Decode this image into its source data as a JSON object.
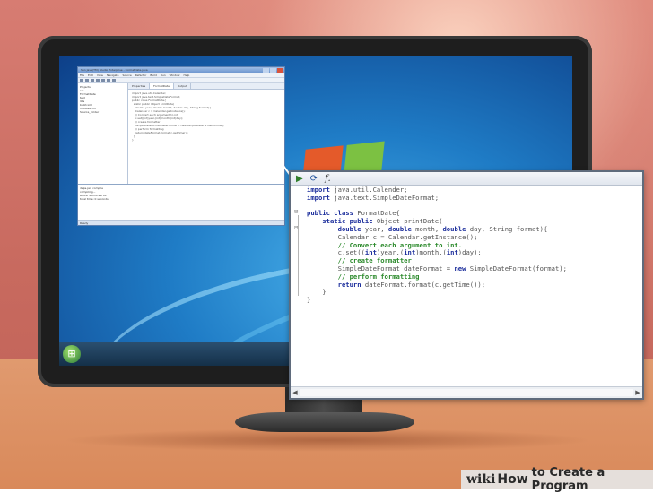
{
  "colors": {
    "wall": "#c86a5f",
    "desk": "#d9895a",
    "keyword": "#1c2e9c",
    "comment": "#2c8a2c",
    "plain": "#555555"
  },
  "ide": {
    "title": "Sun Java(TM) Studio Enterprise - FormatDate.java",
    "menu": [
      "File",
      "Edit",
      "View",
      "Navigate",
      "Source",
      "Refactor",
      "Build",
      "Run",
      "Window",
      "Help"
    ],
    "tree": [
      "Projects",
      "src",
      "FormatDate",
      "test",
      "libs",
      "build.xml",
      "manifest.mf",
      "Source_Folder"
    ],
    "tabs": [
      "Properties",
      "FormatDate",
      "Output"
    ],
    "code_preview": [
      "import java.util.Calender;",
      "import java.text.SimpleDateFormat;",
      "",
      "public class FormatDate{",
      "  static public Object printDate(",
      "    double year, double month, double day, String format){",
      "    Calendar c = Calendar.getInstance();",
      "    // Convert each argument to int.",
      "    c.set((int)year,(int)month,(int)day);",
      "    // create formatter",
      "    SimpleDateFormat dateFormat = new SimpleDateFormat(format);",
      "    // perform formatting",
      "    return dateFormat.format(c.getTime());",
      "  }",
      "}"
    ],
    "output": [
      "deps-jar: compile",
      "compiling...",
      "BUILD SUCCESSFUL",
      "total time: 0 seconds"
    ],
    "status": "Ready"
  },
  "zoom": {
    "toolbar": {
      "run_icon": "play-icon",
      "debug_icon": "debug-icon",
      "function_icon": "function-icon"
    },
    "lines": [
      [
        {
          "t": "import",
          "c": "kw"
        },
        {
          "t": " java.util.Calender;",
          "c": "pl"
        }
      ],
      [
        {
          "t": "import",
          "c": "kw"
        },
        {
          "t": " java.text.SimpleDateFormat;",
          "c": "pl"
        }
      ],
      [],
      [
        {
          "t": "public class",
          "c": "kw"
        },
        {
          "t": " FormatDate{",
          "c": "pl"
        }
      ],
      [
        {
          "t": "    static public",
          "c": "kw"
        },
        {
          "t": " Object printDate(",
          "c": "pl"
        }
      ],
      [
        {
          "t": "        double",
          "c": "kw"
        },
        {
          "t": " year, ",
          "c": "pl"
        },
        {
          "t": "double",
          "c": "kw"
        },
        {
          "t": " month, ",
          "c": "pl"
        },
        {
          "t": "double",
          "c": "kw"
        },
        {
          "t": " day, String format){",
          "c": "pl"
        }
      ],
      [
        {
          "t": "        Calendar c = Calendar.getInstance();",
          "c": "pl"
        }
      ],
      [
        {
          "t": "        // Convert each argument to int.",
          "c": "cm"
        }
      ],
      [
        {
          "t": "        c.set((",
          "c": "pl"
        },
        {
          "t": "int",
          "c": "kw"
        },
        {
          "t": ")year,(",
          "c": "pl"
        },
        {
          "t": "int",
          "c": "kw"
        },
        {
          "t": ")month,(",
          "c": "pl"
        },
        {
          "t": "int",
          "c": "kw"
        },
        {
          "t": ")day);",
          "c": "pl"
        }
      ],
      [
        {
          "t": "        // create formatter",
          "c": "cm"
        }
      ],
      [
        {
          "t": "        SimpleDateFormat dateFormat = ",
          "c": "pl"
        },
        {
          "t": "new",
          "c": "kw"
        },
        {
          "t": " SimpleDateFormat(format);",
          "c": "pl"
        }
      ],
      [
        {
          "t": "        // perform formatting",
          "c": "cm"
        }
      ],
      [
        {
          "t": "        return",
          "c": "kw"
        },
        {
          "t": " dateFormat.format(c.getTime());",
          "c": "pl"
        }
      ],
      [
        {
          "t": "    }",
          "c": "pl"
        }
      ],
      [
        {
          "t": "}",
          "c": "pl"
        }
      ]
    ]
  },
  "watermark": {
    "wiki": "wiki",
    "how": "How",
    "rest": "to Create a Program"
  }
}
